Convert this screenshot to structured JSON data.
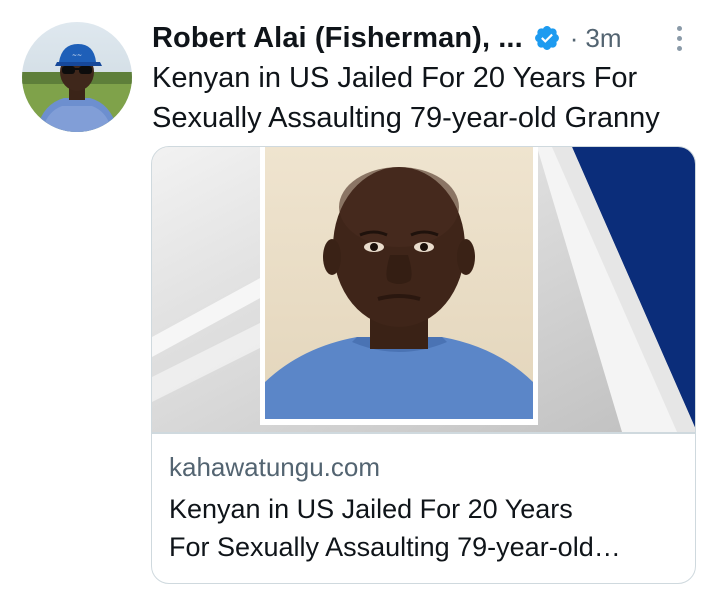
{
  "tweet": {
    "author_name": "Robert Alai (Fisherman), ...",
    "separator": "·",
    "timestamp": "3m",
    "text": "Kenyan in US Jailed For 20 Years For Sexually Assaulting 79-year-old Granny",
    "verified_color": "#1d9bf0"
  },
  "card": {
    "domain": "kahawatungu.com",
    "title_line_1": "Kenyan in US Jailed For 20 Years",
    "title_line_2": "For Sexually Assaulting 79-year-old…"
  },
  "icons": {
    "verified": "verified-badge-icon",
    "more": "more-options-icon"
  },
  "colors": {
    "text_primary": "#0f1419",
    "text_secondary": "#536471",
    "card_border": "#cfd9de",
    "accent_navy": "#0b2d7a"
  }
}
